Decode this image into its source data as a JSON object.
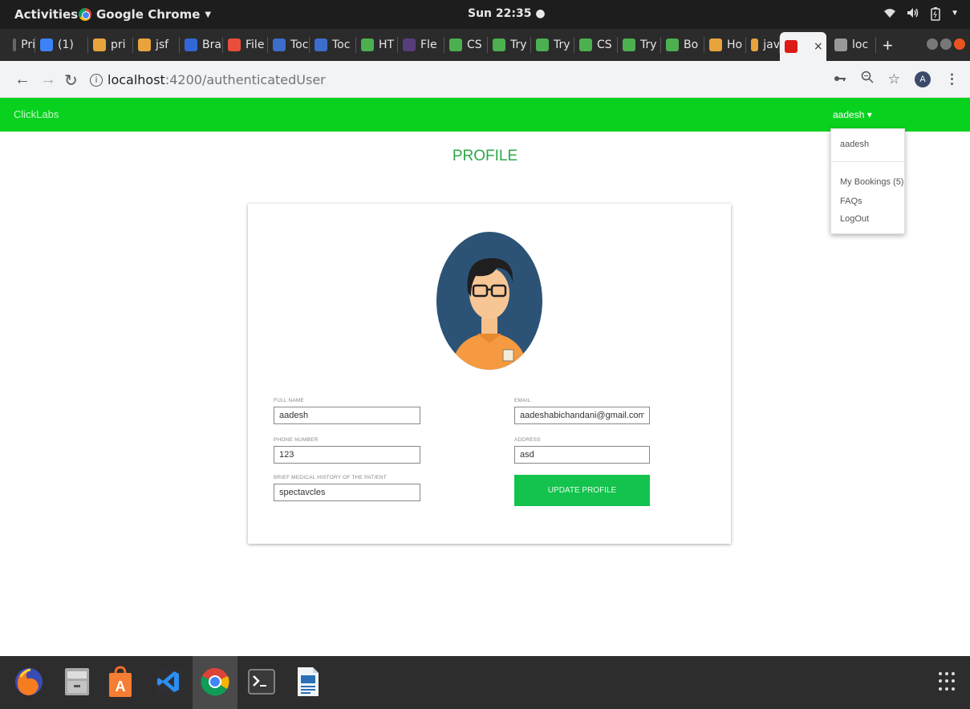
{
  "system": {
    "activities": "Activities",
    "app_name": "Google Chrome",
    "clock": "Sun 22:35"
  },
  "tabs": [
    {
      "label": "Pri",
      "color": "#666666"
    },
    {
      "label": "(1)",
      "color": "#3b82f6"
    },
    {
      "label": "pri",
      "color": "#e8a43c"
    },
    {
      "label": "jsf",
      "color": "#e8a43c"
    },
    {
      "label": "Bra",
      "color": "#3367d6"
    },
    {
      "label": "File",
      "color": "#e94e3c"
    },
    {
      "label": "Toc",
      "color": "#3d6dcc"
    },
    {
      "label": "Toc",
      "color": "#3d6dcc"
    },
    {
      "label": "HT",
      "color": "#4caf50"
    },
    {
      "label": "Fle",
      "color": "#563d7c"
    },
    {
      "label": "CS",
      "color": "#4caf50"
    },
    {
      "label": "Try",
      "color": "#4caf50"
    },
    {
      "label": "Try",
      "color": "#4caf50"
    },
    {
      "label": "CS",
      "color": "#4caf50"
    },
    {
      "label": "Try",
      "color": "#4caf50"
    },
    {
      "label": "Bo",
      "color": "#4caf50"
    },
    {
      "label": "Ho",
      "color": "#e8a43c"
    },
    {
      "label": "jav",
      "color": "#e8a43c"
    },
    {
      "label": "",
      "color": "#dd1b16",
      "active": true
    },
    {
      "label": "loc",
      "color": "#999999"
    }
  ],
  "browser": {
    "url_host": "localhost",
    "url_path": ":4200/authenticatedUser",
    "profile_initial": "A"
  },
  "navbar": {
    "brand": "ClickLabs",
    "user": "aadesh ▾"
  },
  "dropdown": {
    "username": "aadesh",
    "items": [
      "My Bookings (5)",
      "FAQs",
      "LogOut"
    ]
  },
  "page": {
    "title": "PROFILE"
  },
  "form": {
    "full_name_label": "FULL NAME",
    "full_name": "aadesh",
    "email_label": "EMAIL",
    "email": "aadeshabichandani@gmail.com",
    "phone_label": "PHONE NUMBER",
    "phone": "123",
    "address_label": "ADDRESS",
    "address": "asd",
    "history_label": "BRIEF MEDICAL HISTORY OF THE PATIENT",
    "history": "spectavcles",
    "update_button": "UPDATE PROFILE"
  },
  "dock": [
    "firefox-icon",
    "files-icon",
    "software-center-icon",
    "vscode-icon",
    "chrome-icon",
    "terminal-icon",
    "libreoffice-writer-icon",
    "app-grid-icon"
  ],
  "colors": {
    "navbar": "#08d21e",
    "title": "#2ea84a",
    "button": "#13c34e"
  }
}
